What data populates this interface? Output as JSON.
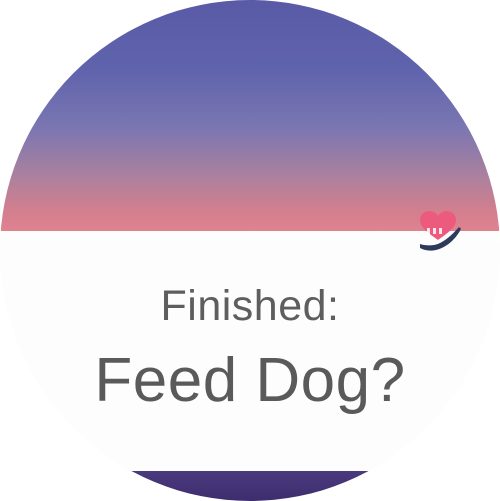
{
  "notification": {
    "status_label": "Finished:",
    "task_label": "Feed Dog?",
    "app_icon": "heart-in-hand-icon"
  },
  "colors": {
    "sky_top": "#5a5aa6",
    "sky_bottom": "#df8290",
    "card_background": "#fdfdfd",
    "text": "#5e5e5e",
    "icon_heart": "#ec5a7e",
    "icon_hand": "#2e3a5c"
  }
}
